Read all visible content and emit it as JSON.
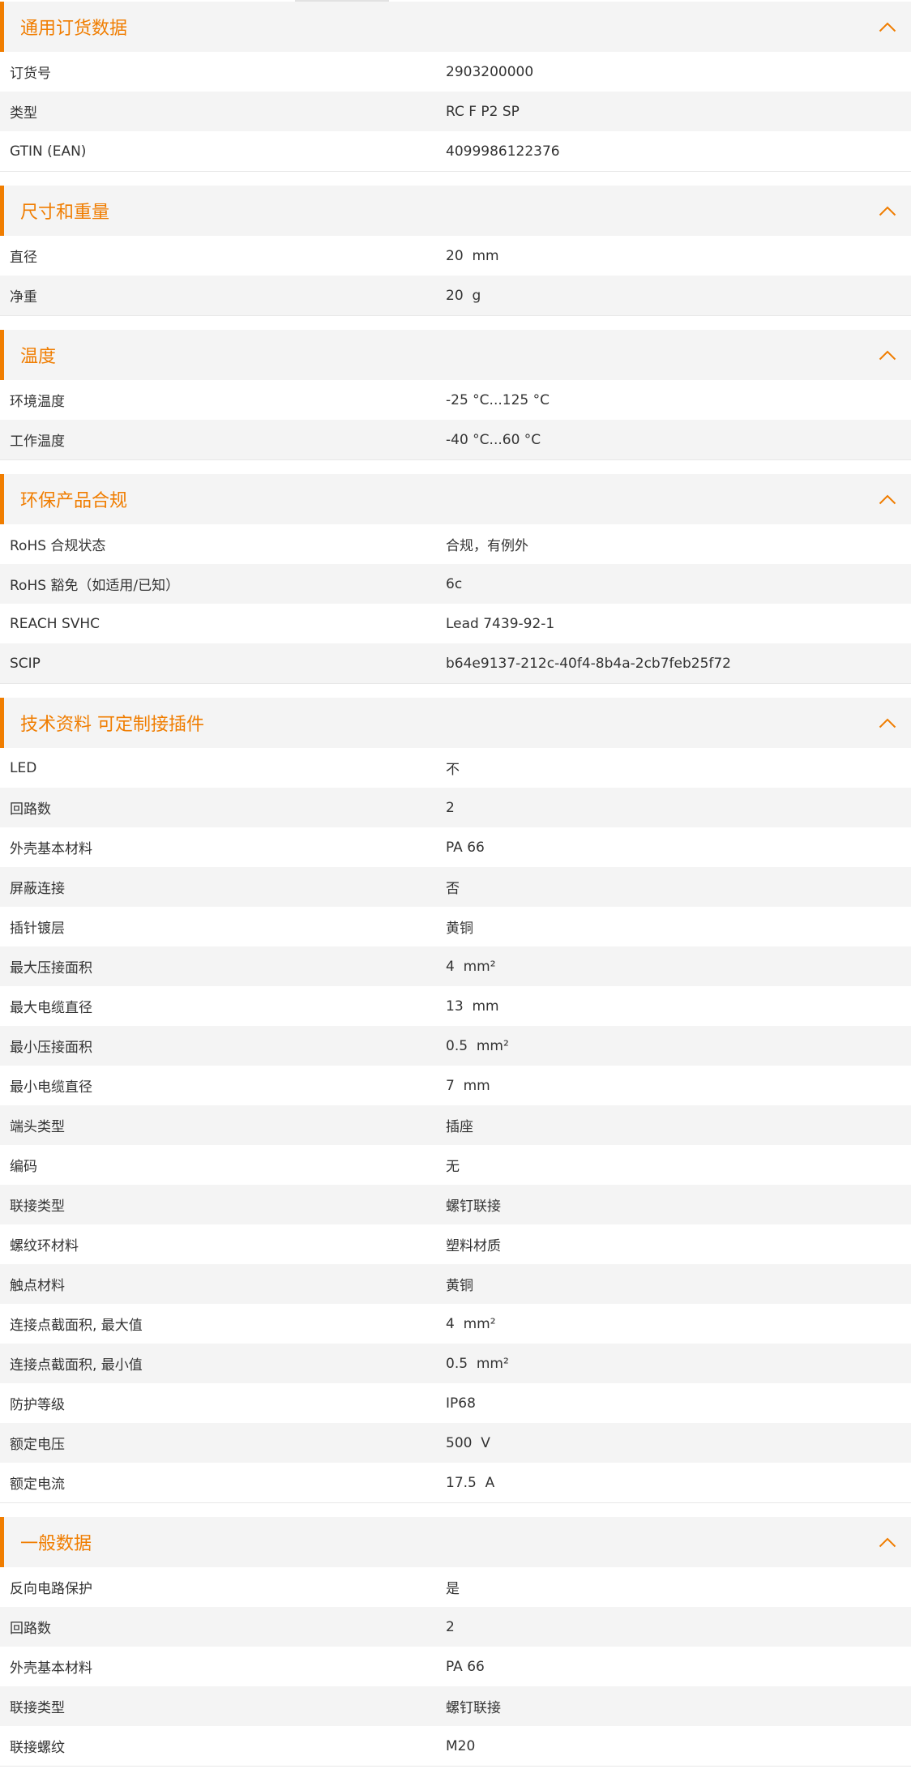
{
  "colors": {
    "accent": "#f07d00",
    "stripe": "#f4f4f4"
  },
  "sections": [
    {
      "title": "通用订货数据",
      "icon": "chevron-up-icon",
      "rows": [
        {
          "label": "订货号",
          "value": "2903200000"
        },
        {
          "label": "类型",
          "value": "RC F P2 SP"
        },
        {
          "label": "GTIN (EAN)",
          "value": "4099986122376"
        }
      ]
    },
    {
      "title": "尺寸和重量",
      "icon": "chevron-up-icon",
      "rows": [
        {
          "label": "直径",
          "value": "20  mm"
        },
        {
          "label": "净重",
          "value": "20  g"
        }
      ]
    },
    {
      "title": "温度",
      "icon": "chevron-up-icon",
      "rows": [
        {
          "label": "环境温度",
          "value": "-25 °C...125 °C"
        },
        {
          "label": "工作温度",
          "value": "-40 °C...60 °C"
        }
      ]
    },
    {
      "title": "环保产品合规",
      "icon": "chevron-up-icon",
      "rows": [
        {
          "label": "RoHS 合规状态",
          "value": "合规，有例外"
        },
        {
          "label": "RoHS 豁免（如适用/已知）",
          "value": "6c"
        },
        {
          "label": "REACH SVHC",
          "value": "Lead 7439-92-1"
        },
        {
          "label": "SCIP",
          "value": "b64e9137-212c-40f4-8b4a-2cb7feb25f72"
        }
      ]
    },
    {
      "title": "技术资料 可定制接插件",
      "icon": "chevron-up-icon",
      "rows": [
        {
          "label": "LED",
          "value": "不"
        },
        {
          "label": "回路数",
          "value": "2"
        },
        {
          "label": "外壳基本材料",
          "value": "PA 66"
        },
        {
          "label": "屏蔽连接",
          "value": "否"
        },
        {
          "label": "插针镀层",
          "value": "黄铜"
        },
        {
          "label": "最大压接面积",
          "value": "4  mm²"
        },
        {
          "label": "最大电缆直径",
          "value": "13  mm"
        },
        {
          "label": "最小压接面积",
          "value": "0.5  mm²"
        },
        {
          "label": "最小电缆直径",
          "value": "7  mm"
        },
        {
          "label": "端头类型",
          "value": "插座"
        },
        {
          "label": "编码",
          "value": "无"
        },
        {
          "label": "联接类型",
          "value": "螺钉联接"
        },
        {
          "label": "螺纹环材料",
          "value": "塑料材质"
        },
        {
          "label": "触点材料",
          "value": "黄铜"
        },
        {
          "label": "连接点截面积, 最大值",
          "value": "4  mm²"
        },
        {
          "label": "连接点截面积, 最小值",
          "value": "0.5  mm²"
        },
        {
          "label": "防护等级",
          "value": "IP68"
        },
        {
          "label": "额定电压",
          "value": "500  V"
        },
        {
          "label": "额定电流",
          "value": "17.5  A"
        }
      ]
    },
    {
      "title": "一般数据",
      "icon": "chevron-up-icon",
      "rows": [
        {
          "label": "反向电路保护",
          "value": "是"
        },
        {
          "label": "回路数",
          "value": "2"
        },
        {
          "label": "外壳基本材料",
          "value": "PA 66"
        },
        {
          "label": "联接类型",
          "value": "螺钉联接"
        },
        {
          "label": "联接螺纹",
          "value": "M20"
        }
      ]
    }
  ]
}
